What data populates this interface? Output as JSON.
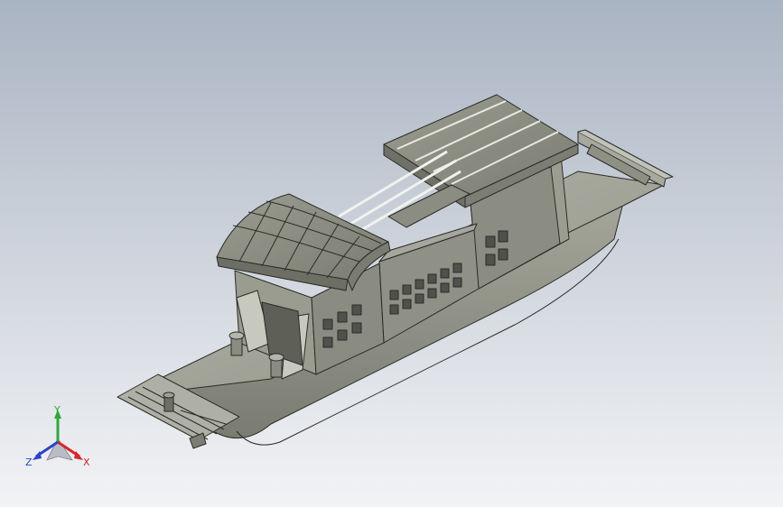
{
  "viewport": {
    "background_top": "#a9b4c2",
    "background_bottom": "#f2f3f5"
  },
  "model": {
    "shading": "shaded-with-edges",
    "body_color": "#8d8f83",
    "edge_color": "#2b2c28",
    "hull_color": "#9b9d91",
    "dark_panel_color": "#4f524b"
  },
  "triad": {
    "x_label": "X",
    "y_label": "Y",
    "z_label": "Z",
    "x_color": "#d8242b",
    "y_color": "#2ea83a",
    "z_color": "#2b43c8"
  }
}
